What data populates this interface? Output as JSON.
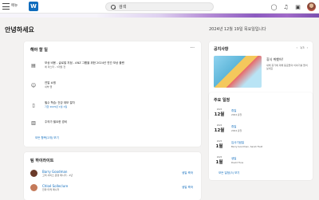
{
  "topbar": {
    "menu_label": "메뉴",
    "search_text": "검색"
  },
  "greeting": "안녕하세요",
  "date": "2024년 12월 19일 목요일입니다",
  "todo": {
    "title": "해야 할 일",
    "items": [
      {
        "icon": "briefcase-icon",
        "text": "보상 비용 - 글로벌 지점 - ANZ 그룹을 위한 2024년 연간 보상 플랜",
        "sub": "에 마스터 - 3개월 전"
      },
      {
        "icon": "person-icon",
        "text": "연말 쇼핑",
        "sub": "내부 앱"
      },
      {
        "icon": "book-icon",
        "text": "필수 학습: 건강 데모 절차",
        "sub": "기한 2025년 1월 1일"
      },
      {
        "icon": "document-icon",
        "text": "주의가 필요한 경비",
        "sub": ""
      }
    ],
    "view_more": "모든 항목(2개) 보기"
  },
  "highlights": {
    "title": "팀 하이라이트",
    "items": [
      {
        "name": "Barry Goodman",
        "role": "고객 서비스 운영 매니저 - 2년",
        "action": "생일 축하",
        "avatar_color": "#6b3b2a"
      },
      {
        "name": "Chloé Solleclure",
        "role": "전략 마케 매니저",
        "action": "생일 축하",
        "avatar_color": "#c47a5a"
      }
    ]
  },
  "notice": {
    "title": "공지사항",
    "page": "1/3",
    "item_title": "휴식 취했어!",
    "item_desc": "새해 휴가에 대해 동료들의 이야기를 들어보세요"
  },
  "events": {
    "title": "주요 일정",
    "items": [
      {
        "year": "2024",
        "day": "12월",
        "title": "휴일",
        "sub": "2024 휴일"
      },
      {
        "year": "2024",
        "day": "12월",
        "title": "휴일",
        "sub": "2024 휴일"
      },
      {
        "year": "2025",
        "day": "1월",
        "title": "입사기념일",
        "sub": "Barry Goodman, Sarah Field"
      },
      {
        "year": "2025",
        "day": "1월",
        "title": "생일",
        "sub": "David Fuss"
      }
    ],
    "view_all": "모든 일정(3) 보기"
  },
  "colors": {
    "accent": "#0f6cbd",
    "banner_purple": "#8c5bc0"
  }
}
